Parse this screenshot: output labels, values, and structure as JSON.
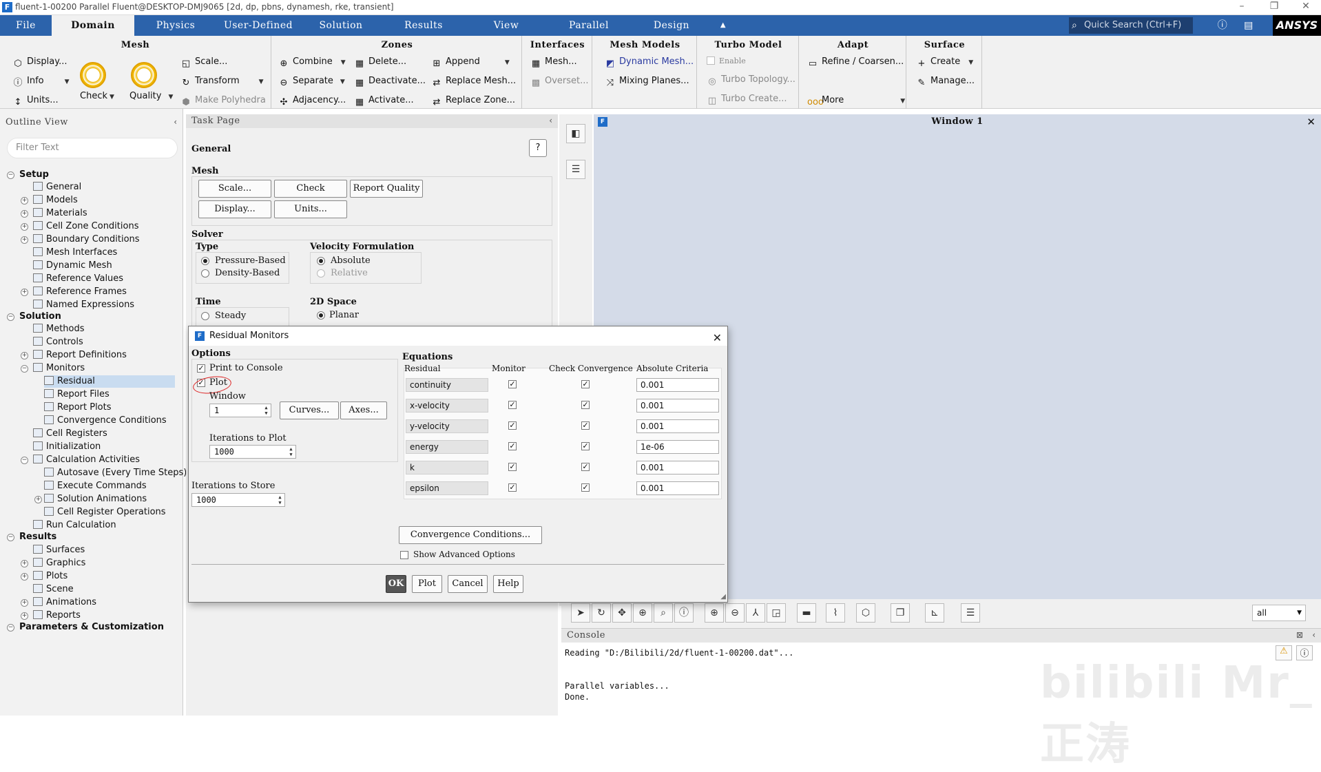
{
  "window": {
    "title": "fluent-1-00200 Parallel Fluent@DESKTOP-DMJ9065  [2d, dp, pbns, dynamesh, rke, transient]",
    "app_icon_letter": "F"
  },
  "menubar": {
    "tabs": [
      "File",
      "Domain",
      "Physics",
      "User-Defined",
      "Solution",
      "Results",
      "View",
      "Parallel",
      "Design"
    ],
    "active": "Domain",
    "search_placeholder": "Quick Search (Ctrl+F)",
    "brand": "ANSYS"
  },
  "ribbon": {
    "mesh": {
      "title": "Mesh",
      "display": "Display...",
      "info": "Info",
      "units": "Units...",
      "check": "Check",
      "quality": "Quality",
      "scale": "Scale...",
      "transform": "Transform",
      "make_polyhedra": "Make Polyhedra"
    },
    "zones": {
      "title": "Zones",
      "combine": "Combine",
      "separate": "Separate",
      "adjacency": "Adjacency...",
      "delete": "Delete...",
      "deactivate": "Deactivate...",
      "activate": "Activate...",
      "append": "Append",
      "replace_mesh": "Replace Mesh...",
      "replace_zone": "Replace Zone..."
    },
    "interfaces": {
      "title": "Interfaces",
      "mesh": "Mesh...",
      "overset": "Overset..."
    },
    "mesh_models": {
      "title": "Mesh Models",
      "dynamic_mesh": "Dynamic Mesh...",
      "mixing_planes": "Mixing Planes..."
    },
    "turbo": {
      "title": "Turbo Model",
      "enable": "Enable",
      "topology": "Turbo Topology...",
      "create": "Turbo Create..."
    },
    "adapt": {
      "title": "Adapt",
      "refine": "Refine / Coarsen...",
      "more": "More"
    },
    "surface": {
      "title": "Surface",
      "create": "Create",
      "manage": "Manage..."
    }
  },
  "outline": {
    "header": "Outline View",
    "filter_placeholder": "Filter Text",
    "nodes": [
      {
        "label": "Setup",
        "bold": true
      },
      {
        "label": "General"
      },
      {
        "label": "Models"
      },
      {
        "label": "Materials"
      },
      {
        "label": "Cell Zone Conditions"
      },
      {
        "label": "Boundary Conditions"
      },
      {
        "label": "Mesh Interfaces"
      },
      {
        "label": "Dynamic Mesh"
      },
      {
        "label": "Reference Values"
      },
      {
        "label": "Reference Frames"
      },
      {
        "label": "Named Expressions"
      },
      {
        "label": "Solution",
        "bold": true
      },
      {
        "label": "Methods"
      },
      {
        "label": "Controls"
      },
      {
        "label": "Report Definitions"
      },
      {
        "label": "Monitors"
      },
      {
        "label": "Residual"
      },
      {
        "label": "Report Files"
      },
      {
        "label": "Report Plots"
      },
      {
        "label": "Convergence Conditions"
      },
      {
        "label": "Cell Registers"
      },
      {
        "label": "Initialization"
      },
      {
        "label": "Calculation Activities"
      },
      {
        "label": "Autosave (Every Time Steps)"
      },
      {
        "label": "Execute Commands"
      },
      {
        "label": "Solution Animations"
      },
      {
        "label": "Cell Register Operations"
      },
      {
        "label": "Run Calculation"
      },
      {
        "label": "Results",
        "bold": true
      },
      {
        "label": "Surfaces"
      },
      {
        "label": "Graphics"
      },
      {
        "label": "Plots"
      },
      {
        "label": "Scene"
      },
      {
        "label": "Animations"
      },
      {
        "label": "Reports"
      },
      {
        "label": "Parameters & Customization",
        "bold": true
      }
    ]
  },
  "taskpage": {
    "header": "Task Page",
    "title": "General",
    "mesh_label": "Mesh",
    "scale": "Scale...",
    "check": "Check",
    "report_quality": "Report Quality",
    "display": "Display...",
    "units": "Units...",
    "solver_label": "Solver",
    "type_label": "Type",
    "pressure_based": "Pressure-Based",
    "density_based": "Density-Based",
    "velocity_label": "Velocity Formulation",
    "absolute": "Absolute",
    "relative": "Relative",
    "time_label": "Time",
    "steady": "Steady",
    "space_label": "2D Space",
    "planar": "Planar"
  },
  "graphics": {
    "window_title": "Window 1",
    "selector": "all"
  },
  "console": {
    "header": "Console",
    "lines": [
      "Reading \"D:/Bilibili/2d/fluent-1-00200.dat\"...",
      "",
      "",
      "Parallel variables...",
      "Done."
    ]
  },
  "dialog": {
    "title": "Residual Monitors",
    "options_label": "Options",
    "print_to_console": "Print to Console",
    "plot": "Plot",
    "window_label": "Window",
    "window_value": "1",
    "curves": "Curves...",
    "axes": "Axes...",
    "iter_plot_label": "Iterations to Plot",
    "iter_plot_value": "1000",
    "iter_store_label": "Iterations to Store",
    "iter_store_value": "1000",
    "equations_label": "Equations",
    "col_residual": "Residual",
    "col_monitor": "Monitor",
    "col_check": "Check Convergence",
    "col_criteria": "Absolute Criteria",
    "rows": [
      {
        "name": "continuity",
        "criteria": "0.001"
      },
      {
        "name": "x-velocity",
        "criteria": "0.001"
      },
      {
        "name": "y-velocity",
        "criteria": "0.001"
      },
      {
        "name": "energy",
        "criteria": "1e-06"
      },
      {
        "name": "k",
        "criteria": "0.001"
      },
      {
        "name": "epsilon",
        "criteria": "0.001"
      }
    ],
    "convergence_conditions": "Convergence Conditions...",
    "show_advanced": "Show Advanced Options",
    "ok": "OK",
    "plot_btn": "Plot",
    "cancel": "Cancel",
    "help": "Help"
  },
  "watermark": "bilibili Mr_正涛"
}
